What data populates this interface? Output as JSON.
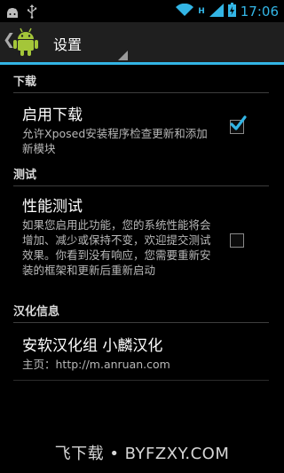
{
  "status_bar": {
    "time": "17:06",
    "network_badge": "H",
    "icons": [
      "android-debug-icon",
      "usb-icon",
      "wifi-icon",
      "signal-icon",
      "battery-icon"
    ]
  },
  "action_bar": {
    "title": "设置"
  },
  "sections": [
    {
      "header": "下载"
    },
    {
      "header": "测试"
    },
    {
      "header": "汉化信息"
    }
  ],
  "prefs": {
    "download": {
      "title": "启用下载",
      "summary": "允许Xposed安装程序检查更新和添加新模块",
      "checked": true
    },
    "perf": {
      "title": "性能测试",
      "summary": "如果您启用此功能，您的系统性能将会增加、减少或保持不变，欢迎提交测试效果。你看到没有响应，您需要重新安装的框架和更新后重新启动",
      "checked": false
    },
    "credits": {
      "title": "安软汉化组 小麟汉化",
      "summary": "主页：http://m.anruan.com"
    }
  },
  "watermark": "飞下载 • BYFZXY.COM",
  "colors": {
    "accent": "#33b5e5",
    "background": "#000000",
    "actionbar": "#1f1f1f"
  }
}
